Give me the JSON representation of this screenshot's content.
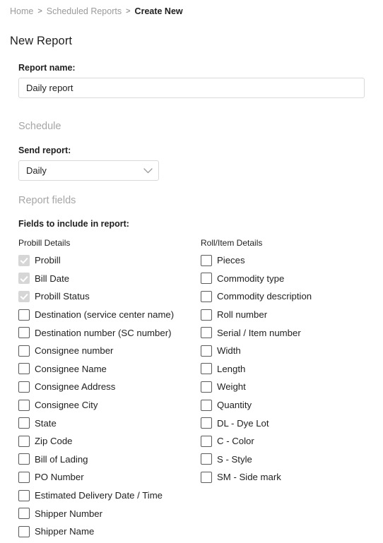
{
  "breadcrumb": {
    "items": [
      {
        "label": "Home",
        "current": false
      },
      {
        "label": "Scheduled Reports",
        "current": false
      },
      {
        "label": "Create New",
        "current": true
      }
    ],
    "separator": ">"
  },
  "page": {
    "title": "New Report"
  },
  "report_name": {
    "label": "Report name:",
    "value": "Daily report",
    "placeholder": "Report name"
  },
  "schedule": {
    "heading": "Schedule",
    "send_report_label": "Send report:",
    "send_report_value": "Daily",
    "send_report_options": [
      "Daily"
    ],
    "chevron_icon": "chevron-down-icon"
  },
  "report_fields": {
    "heading": "Report fields",
    "instruction": "Fields to include in report:",
    "columns": [
      {
        "heading": "Probill Details",
        "items": [
          {
            "label": "Probill",
            "checked": true,
            "disabled": true
          },
          {
            "label": "Bill Date",
            "checked": true,
            "disabled": true
          },
          {
            "label": "Probill Status",
            "checked": true,
            "disabled": true
          },
          {
            "label": "Destination (service center name)",
            "checked": false,
            "disabled": false
          },
          {
            "label": "Destination number (SC number)",
            "checked": false,
            "disabled": false
          },
          {
            "label": "Consignee number",
            "checked": false,
            "disabled": false
          },
          {
            "label": "Consignee Name",
            "checked": false,
            "disabled": false
          },
          {
            "label": "Consignee Address",
            "checked": false,
            "disabled": false
          },
          {
            "label": "Consignee City",
            "checked": false,
            "disabled": false
          },
          {
            "label": "State",
            "checked": false,
            "disabled": false
          },
          {
            "label": "Zip Code",
            "checked": false,
            "disabled": false
          },
          {
            "label": "Bill of Lading",
            "checked": false,
            "disabled": false
          },
          {
            "label": "PO Number",
            "checked": false,
            "disabled": false
          },
          {
            "label": "Estimated Delivery Date / Time",
            "checked": false,
            "disabled": false
          },
          {
            "label": "Shipper Number",
            "checked": false,
            "disabled": false
          },
          {
            "label": "Shipper Name",
            "checked": false,
            "disabled": false
          }
        ]
      },
      {
        "heading": "Roll/Item Details",
        "items": [
          {
            "label": "Pieces",
            "checked": false,
            "disabled": false
          },
          {
            "label": "Commodity type",
            "checked": false,
            "disabled": false
          },
          {
            "label": "Commodity description",
            "checked": false,
            "disabled": false
          },
          {
            "label": "Roll number",
            "checked": false,
            "disabled": false
          },
          {
            "label": "Serial / Item number",
            "checked": false,
            "disabled": false
          },
          {
            "label": "Width",
            "checked": false,
            "disabled": false
          },
          {
            "label": "Length",
            "checked": false,
            "disabled": false
          },
          {
            "label": "Weight",
            "checked": false,
            "disabled": false
          },
          {
            "label": "Quantity",
            "checked": false,
            "disabled": false
          },
          {
            "label": "DL - Dye Lot",
            "checked": false,
            "disabled": false
          },
          {
            "label": "C - Color",
            "checked": false,
            "disabled": false
          },
          {
            "label": "S - Style",
            "checked": false,
            "disabled": false
          },
          {
            "label": "SM - Side mark",
            "checked": false,
            "disabled": false
          }
        ]
      }
    ]
  },
  "colors": {
    "text": "#1f1f1f",
    "muted": "#a6a6a6",
    "border": "#d9d9d9",
    "checkbox_border": "#5a5a5a",
    "checkbox_disabled_fill": "#d6d6d6"
  }
}
